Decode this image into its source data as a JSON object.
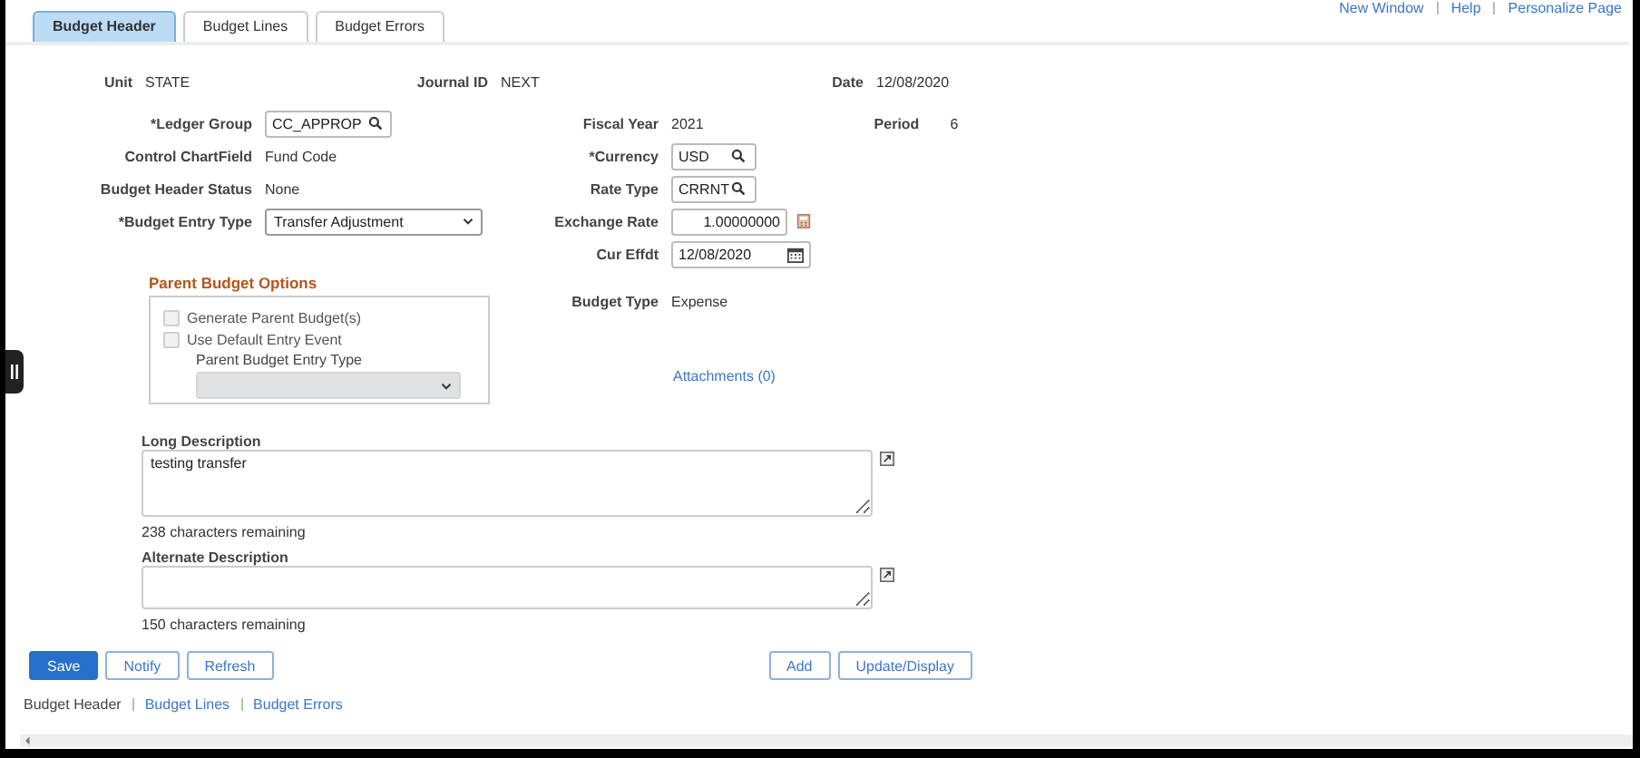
{
  "top_links": [
    "New Window",
    "Help",
    "Personalize Page"
  ],
  "tabs": [
    {
      "label": "Budget Header",
      "selected": true
    },
    {
      "label": "Budget Lines",
      "selected": false
    },
    {
      "label": "Budget Errors",
      "selected": false
    }
  ],
  "header_fields": [
    {
      "label": "Unit",
      "value": "STATE"
    },
    {
      "label": "Journal ID",
      "value": "NEXT"
    },
    {
      "label": "Date",
      "value": "12/08/2020"
    }
  ],
  "left_fields": [
    {
      "kind": "lookup",
      "label": "*Ledger Group",
      "value": "CC_APPROP"
    },
    {
      "kind": "text",
      "label": "Control ChartField",
      "value": "Fund Code"
    },
    {
      "kind": "text",
      "label": "Budget Header Status",
      "value": "None"
    },
    {
      "kind": "select",
      "label": "*Budget Entry Type",
      "value": "Transfer Adjustment"
    }
  ],
  "right_fields": [
    {
      "kind": "text",
      "label": "Fiscal Year",
      "value": "2021"
    },
    {
      "kind": "lookup",
      "label": "*Currency",
      "value": "USD"
    },
    {
      "kind": "lookup",
      "label": "Rate Type",
      "value": "CRRNT"
    },
    {
      "kind": "number",
      "label": "Exchange Rate",
      "value": "1.00000000"
    },
    {
      "kind": "date",
      "label": "Cur Effdt",
      "value": "12/08/2020"
    }
  ],
  "period": {
    "label": "Period",
    "value": "6"
  },
  "parent_budget_options": {
    "title": "Parent Budget Options",
    "checkboxes": [
      {
        "label": "Generate Parent Budget(s)",
        "checked": false,
        "disabled": true
      },
      {
        "label": "Use Default Entry Event",
        "checked": false,
        "disabled": true
      }
    ],
    "entry_type": {
      "label": "Parent Budget Entry Type",
      "disabled": true
    }
  },
  "budget_type": {
    "label": "Budget Type",
    "value": "Expense"
  },
  "attachments_link": "Attachments (0)",
  "descriptions": [
    {
      "label": "Long Description",
      "value": "testing transfer",
      "remaining": "238 characters remaining"
    },
    {
      "label": "Alternate Description",
      "remaining": "150 characters remaining"
    }
  ],
  "buttons_left": [
    {
      "label": "Save",
      "primary": true
    },
    {
      "label": "Notify",
      "primary": false
    },
    {
      "label": "Refresh",
      "primary": false
    }
  ],
  "buttons_right": [
    {
      "label": "Add",
      "primary": false
    },
    {
      "label": "Update/Display",
      "primary": false
    }
  ],
  "bottom_links": [
    {
      "label": "Budget Header",
      "selected": true
    },
    {
      "label": "Budget Lines",
      "selected": false
    },
    {
      "label": "Budget Errors",
      "selected": false
    }
  ]
}
